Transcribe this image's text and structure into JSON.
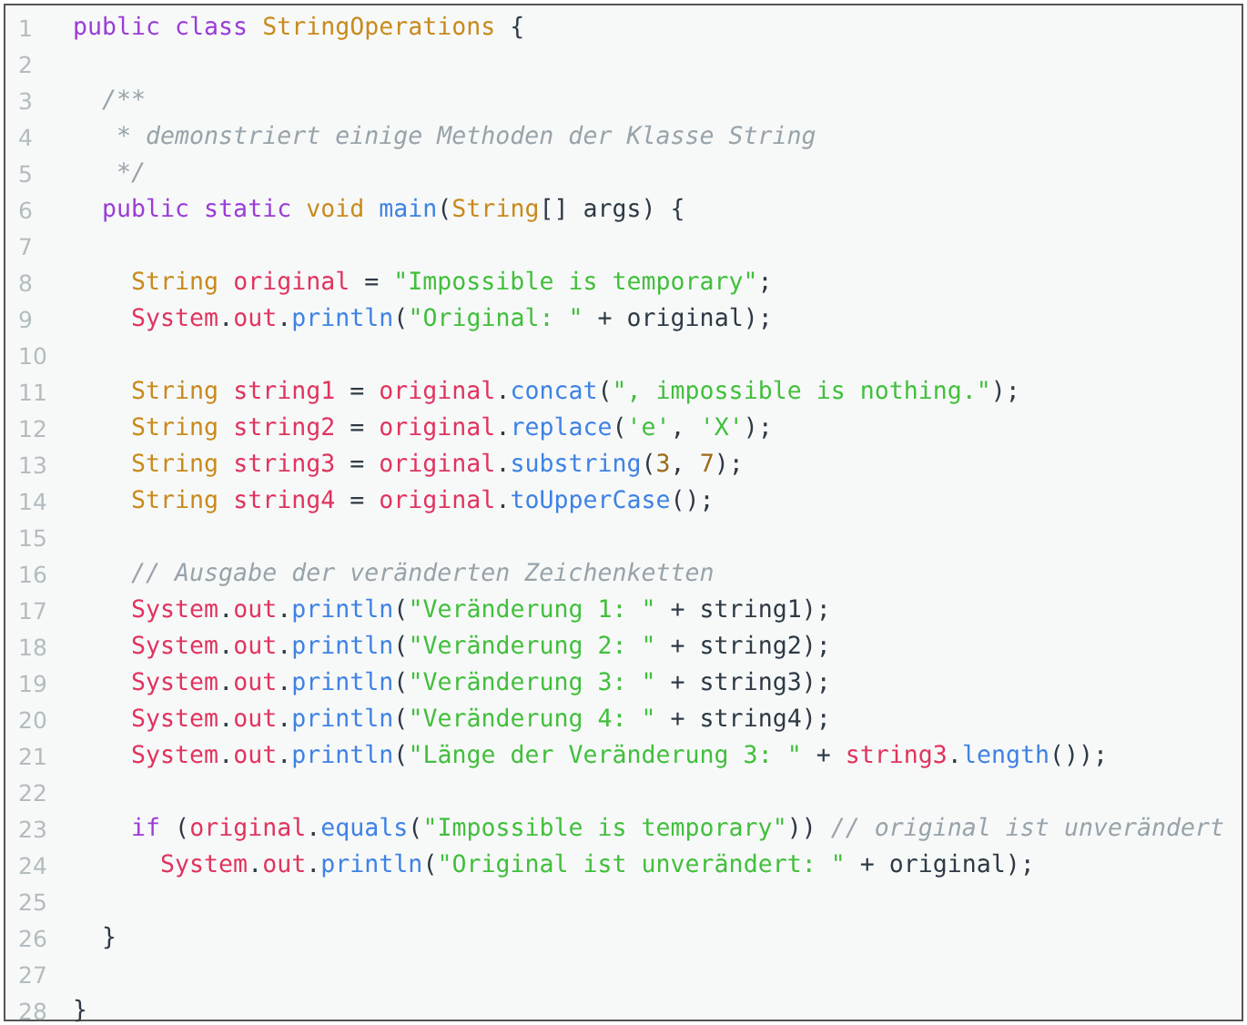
{
  "editor": {
    "lines": [
      {
        "number": "1",
        "tokens": [
          {
            "kind": "keyword",
            "text": "public class "
          },
          {
            "kind": "type",
            "text": "StringOperations"
          },
          {
            "kind": "plain",
            "text": " {"
          }
        ]
      },
      {
        "number": "2"
      },
      {
        "number": "3",
        "tokens": [
          {
            "kind": "comment",
            "text": "  /**"
          }
        ]
      },
      {
        "number": "4",
        "tokens": [
          {
            "kind": "comment",
            "text": "   * demonstriert einige Methoden der Klasse String"
          }
        ]
      },
      {
        "number": "5",
        "tokens": [
          {
            "kind": "comment",
            "text": "   */"
          }
        ]
      },
      {
        "number": "6",
        "tokens": [
          {
            "kind": "keyword",
            "text": "  public static "
          },
          {
            "kind": "type",
            "text": "void "
          },
          {
            "kind": "method",
            "text": "main"
          },
          {
            "kind": "plain",
            "text": "("
          },
          {
            "kind": "type",
            "text": "String"
          },
          {
            "kind": "plain",
            "text": "[] args) {"
          }
        ]
      },
      {
        "number": "7"
      },
      {
        "number": "8",
        "tokens": [
          {
            "kind": "type",
            "text": "    String "
          },
          {
            "kind": "variable",
            "text": "original"
          },
          {
            "kind": "plain",
            "text": " = "
          },
          {
            "kind": "string",
            "text": "\"Impossible is temporary\""
          },
          {
            "kind": "plain",
            "text": ";"
          }
        ]
      },
      {
        "number": "9",
        "tokens": [
          {
            "kind": "variable",
            "text": "    System"
          },
          {
            "kind": "plain",
            "text": "."
          },
          {
            "kind": "variable",
            "text": "out"
          },
          {
            "kind": "plain",
            "text": "."
          },
          {
            "kind": "method",
            "text": "println"
          },
          {
            "kind": "plain",
            "text": "("
          },
          {
            "kind": "string",
            "text": "\"Original: \""
          },
          {
            "kind": "plain",
            "text": " + original);"
          }
        ]
      },
      {
        "number": "10"
      },
      {
        "number": "11",
        "tokens": [
          {
            "kind": "type",
            "text": "    String "
          },
          {
            "kind": "variable",
            "text": "string1"
          },
          {
            "kind": "plain",
            "text": " = "
          },
          {
            "kind": "variable",
            "text": "original"
          },
          {
            "kind": "plain",
            "text": "."
          },
          {
            "kind": "method",
            "text": "concat"
          },
          {
            "kind": "plain",
            "text": "("
          },
          {
            "kind": "string",
            "text": "\", impossible is nothing.\""
          },
          {
            "kind": "plain",
            "text": ");"
          }
        ]
      },
      {
        "number": "12",
        "tokens": [
          {
            "kind": "type",
            "text": "    String "
          },
          {
            "kind": "variable",
            "text": "string2"
          },
          {
            "kind": "plain",
            "text": " = "
          },
          {
            "kind": "variable",
            "text": "original"
          },
          {
            "kind": "plain",
            "text": "."
          },
          {
            "kind": "method",
            "text": "replace"
          },
          {
            "kind": "plain",
            "text": "("
          },
          {
            "kind": "string",
            "text": "'e'"
          },
          {
            "kind": "plain",
            "text": ", "
          },
          {
            "kind": "string",
            "text": "'X'"
          },
          {
            "kind": "plain",
            "text": ");"
          }
        ]
      },
      {
        "number": "13",
        "tokens": [
          {
            "kind": "type",
            "text": "    String "
          },
          {
            "kind": "variable",
            "text": "string3"
          },
          {
            "kind": "plain",
            "text": " = "
          },
          {
            "kind": "variable",
            "text": "original"
          },
          {
            "kind": "plain",
            "text": "."
          },
          {
            "kind": "method",
            "text": "substring"
          },
          {
            "kind": "plain",
            "text": "("
          },
          {
            "kind": "number",
            "text": "3"
          },
          {
            "kind": "plain",
            "text": ", "
          },
          {
            "kind": "number",
            "text": "7"
          },
          {
            "kind": "plain",
            "text": ");"
          }
        ]
      },
      {
        "number": "14",
        "tokens": [
          {
            "kind": "type",
            "text": "    String "
          },
          {
            "kind": "variable",
            "text": "string4"
          },
          {
            "kind": "plain",
            "text": " = "
          },
          {
            "kind": "variable",
            "text": "original"
          },
          {
            "kind": "plain",
            "text": "."
          },
          {
            "kind": "method",
            "text": "toUpperCase"
          },
          {
            "kind": "plain",
            "text": "();"
          }
        ]
      },
      {
        "number": "15"
      },
      {
        "number": "16",
        "tokens": [
          {
            "kind": "comment",
            "text": "    // Ausgabe der veränderten Zeichenketten"
          }
        ]
      },
      {
        "number": "17",
        "tokens": [
          {
            "kind": "variable",
            "text": "    System"
          },
          {
            "kind": "plain",
            "text": "."
          },
          {
            "kind": "variable",
            "text": "out"
          },
          {
            "kind": "plain",
            "text": "."
          },
          {
            "kind": "method",
            "text": "println"
          },
          {
            "kind": "plain",
            "text": "("
          },
          {
            "kind": "string",
            "text": "\"Veränderung 1: \""
          },
          {
            "kind": "plain",
            "text": " + string1);"
          }
        ]
      },
      {
        "number": "18",
        "tokens": [
          {
            "kind": "variable",
            "text": "    System"
          },
          {
            "kind": "plain",
            "text": "."
          },
          {
            "kind": "variable",
            "text": "out"
          },
          {
            "kind": "plain",
            "text": "."
          },
          {
            "kind": "method",
            "text": "println"
          },
          {
            "kind": "plain",
            "text": "("
          },
          {
            "kind": "string",
            "text": "\"Veränderung 2: \""
          },
          {
            "kind": "plain",
            "text": " + string2);"
          }
        ]
      },
      {
        "number": "19",
        "tokens": [
          {
            "kind": "variable",
            "text": "    System"
          },
          {
            "kind": "plain",
            "text": "."
          },
          {
            "kind": "variable",
            "text": "out"
          },
          {
            "kind": "plain",
            "text": "."
          },
          {
            "kind": "method",
            "text": "println"
          },
          {
            "kind": "plain",
            "text": "("
          },
          {
            "kind": "string",
            "text": "\"Veränderung 3: \""
          },
          {
            "kind": "plain",
            "text": " + string3);"
          }
        ]
      },
      {
        "number": "20",
        "tokens": [
          {
            "kind": "variable",
            "text": "    System"
          },
          {
            "kind": "plain",
            "text": "."
          },
          {
            "kind": "variable",
            "text": "out"
          },
          {
            "kind": "plain",
            "text": "."
          },
          {
            "kind": "method",
            "text": "println"
          },
          {
            "kind": "plain",
            "text": "("
          },
          {
            "kind": "string",
            "text": "\"Veränderung 4: \""
          },
          {
            "kind": "plain",
            "text": " + string4);"
          }
        ]
      },
      {
        "number": "21",
        "tokens": [
          {
            "kind": "variable",
            "text": "    System"
          },
          {
            "kind": "plain",
            "text": "."
          },
          {
            "kind": "variable",
            "text": "out"
          },
          {
            "kind": "plain",
            "text": "."
          },
          {
            "kind": "method",
            "text": "println"
          },
          {
            "kind": "plain",
            "text": "("
          },
          {
            "kind": "string",
            "text": "\"Länge der Veränderung 3: \""
          },
          {
            "kind": "plain",
            "text": " + "
          },
          {
            "kind": "variable",
            "text": "string3"
          },
          {
            "kind": "plain",
            "text": "."
          },
          {
            "kind": "method",
            "text": "length"
          },
          {
            "kind": "plain",
            "text": "());"
          }
        ]
      },
      {
        "number": "22"
      },
      {
        "number": "23",
        "tokens": [
          {
            "kind": "keyword",
            "text": "    if"
          },
          {
            "kind": "plain",
            "text": " ("
          },
          {
            "kind": "variable",
            "text": "original"
          },
          {
            "kind": "plain",
            "text": "."
          },
          {
            "kind": "method",
            "text": "equals"
          },
          {
            "kind": "plain",
            "text": "("
          },
          {
            "kind": "string",
            "text": "\"Impossible is temporary\""
          },
          {
            "kind": "plain",
            "text": ")) "
          },
          {
            "kind": "comment",
            "text": "// original ist unverändert"
          }
        ]
      },
      {
        "number": "24",
        "tokens": [
          {
            "kind": "variable",
            "text": "      System"
          },
          {
            "kind": "plain",
            "text": "."
          },
          {
            "kind": "variable",
            "text": "out"
          },
          {
            "kind": "plain",
            "text": "."
          },
          {
            "kind": "method",
            "text": "println"
          },
          {
            "kind": "plain",
            "text": "("
          },
          {
            "kind": "string",
            "text": "\"Original ist unverändert: \""
          },
          {
            "kind": "plain",
            "text": " + original);"
          }
        ]
      },
      {
        "number": "25"
      },
      {
        "number": "26",
        "tokens": [
          {
            "kind": "plain",
            "text": "  }"
          }
        ]
      },
      {
        "number": "27"
      },
      {
        "number": "28",
        "tokens": [
          {
            "kind": "plain",
            "text": "}"
          }
        ]
      }
    ]
  }
}
